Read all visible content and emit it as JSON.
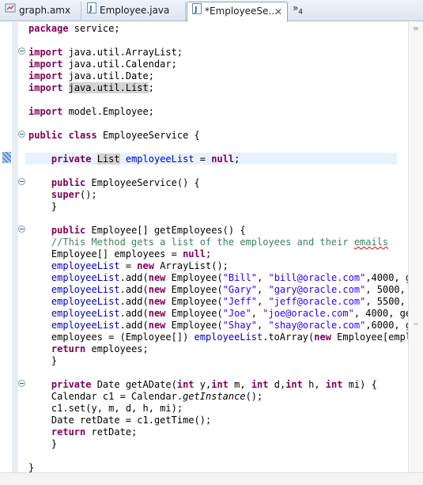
{
  "tabs": [
    {
      "label": "graph.amx",
      "icon": "amx-file-icon",
      "active": false
    },
    {
      "label": "Employee.java",
      "icon": "java-file-icon",
      "active": false
    },
    {
      "label": "*EmployeeSe...",
      "icon": "java-file-icon",
      "active": true
    }
  ],
  "tab_overflow": {
    "glyph": "»",
    "count": "4"
  },
  "close_glyph": "✕",
  "colors": {
    "keyword": "#7f0055",
    "field": "#0000c0",
    "string": "#2a00ff",
    "comment": "#3f7f5f",
    "current_line": "#e8f2fe"
  },
  "code_lines": [
    [
      {
        "t": "package",
        "c": "kw"
      },
      {
        "t": " service;"
      }
    ],
    [],
    [
      {
        "t": "import",
        "c": "kw"
      },
      {
        "t": " java.util.ArrayList;"
      }
    ],
    [
      {
        "t": "import",
        "c": "kw"
      },
      {
        "t": " java.util.Calendar;"
      }
    ],
    [
      {
        "t": "import",
        "c": "kw"
      },
      {
        "t": " java.util.Date;"
      }
    ],
    [
      {
        "t": "import",
        "c": "kw"
      },
      {
        "t": " "
      },
      {
        "t": "java.util.List",
        "c": "hl"
      },
      {
        "t": ";"
      }
    ],
    [],
    [
      {
        "t": "import",
        "c": "kw"
      },
      {
        "t": " model.Employee;"
      }
    ],
    [],
    [
      {
        "t": "public",
        "c": "kw"
      },
      {
        "t": " "
      },
      {
        "t": "class",
        "c": "kw"
      },
      {
        "t": " EmployeeService {"
      }
    ],
    [],
    [
      {
        "t": "    "
      },
      {
        "t": "private",
        "c": "kw"
      },
      {
        "t": " "
      },
      {
        "t": "List",
        "c": "hl"
      },
      {
        "t": " "
      },
      {
        "t": "employeeList",
        "c": "fld"
      },
      {
        "t": " = "
      },
      {
        "t": "null",
        "c": "kw"
      },
      {
        "t": ";"
      }
    ],
    [],
    [
      {
        "t": "    "
      },
      {
        "t": "public",
        "c": "kw"
      },
      {
        "t": " EmployeeService() {"
      }
    ],
    [
      {
        "t": "    "
      },
      {
        "t": "super",
        "c": "kw"
      },
      {
        "t": "();"
      }
    ],
    [
      {
        "t": "    }"
      }
    ],
    [],
    [
      {
        "t": "    "
      },
      {
        "t": "public",
        "c": "kw"
      },
      {
        "t": " Employee[] getEmployees() {"
      }
    ],
    [
      {
        "t": "    "
      },
      {
        "t": "//This Method gets a list of the employees and their ",
        "c": "cmt"
      },
      {
        "t": "emails",
        "c": "cmt sq"
      }
    ],
    [
      {
        "t": "    Employee[] employees = "
      },
      {
        "t": "null",
        "c": "kw"
      },
      {
        "t": ";"
      }
    ],
    [
      {
        "t": "    "
      },
      {
        "t": "employeeList",
        "c": "fld"
      },
      {
        "t": " = "
      },
      {
        "t": "new",
        "c": "kw"
      },
      {
        "t": " ArrayList();"
      }
    ],
    [
      {
        "t": "    "
      },
      {
        "t": "employeeList",
        "c": "fld"
      },
      {
        "t": ".add("
      },
      {
        "t": "new",
        "c": "kw"
      },
      {
        "t": " Employee("
      },
      {
        "t": "\"Bill\"",
        "c": "str"
      },
      {
        "t": ", "
      },
      {
        "t": "\"bill@oracle.com\"",
        "c": "str"
      },
      {
        "t": ",4000, g"
      }
    ],
    [
      {
        "t": "    "
      },
      {
        "t": "employeeList",
        "c": "fld"
      },
      {
        "t": ".add("
      },
      {
        "t": "new",
        "c": "kw"
      },
      {
        "t": " Employee("
      },
      {
        "t": "\"Gary\"",
        "c": "str"
      },
      {
        "t": ", "
      },
      {
        "t": "\"gary@oracle.com\"",
        "c": "str"
      },
      {
        "t": ", 5000, "
      }
    ],
    [
      {
        "t": "    "
      },
      {
        "t": "employeeList",
        "c": "fld"
      },
      {
        "t": ".add("
      },
      {
        "t": "new",
        "c": "kw"
      },
      {
        "t": " Employee("
      },
      {
        "t": "\"Jeff\"",
        "c": "str"
      },
      {
        "t": ", "
      },
      {
        "t": "\"jeff@oracle.com\"",
        "c": "str"
      },
      {
        "t": ", 5500, "
      }
    ],
    [
      {
        "t": "    "
      },
      {
        "t": "employeeList",
        "c": "fld"
      },
      {
        "t": ".add("
      },
      {
        "t": "new",
        "c": "kw"
      },
      {
        "t": " Employee("
      },
      {
        "t": "\"Joe\"",
        "c": "str"
      },
      {
        "t": ", "
      },
      {
        "t": "\"joe@oracle.com\"",
        "c": "str"
      },
      {
        "t": ", 4000, ge"
      }
    ],
    [
      {
        "t": "    "
      },
      {
        "t": "employeeList",
        "c": "fld"
      },
      {
        "t": ".add("
      },
      {
        "t": "new",
        "c": "kw"
      },
      {
        "t": " Employee("
      },
      {
        "t": "\"Shay\"",
        "c": "str"
      },
      {
        "t": ", "
      },
      {
        "t": "\"shay@oracle.com\"",
        "c": "str"
      },
      {
        "t": ",6000, g"
      }
    ],
    [
      {
        "t": "    employees = (Employee[]) "
      },
      {
        "t": "employeeList",
        "c": "fld"
      },
      {
        "t": ".toArray("
      },
      {
        "t": "new",
        "c": "kw"
      },
      {
        "t": " Employee[empl"
      }
    ],
    [
      {
        "t": "    "
      },
      {
        "t": "return",
        "c": "kw"
      },
      {
        "t": " employees;"
      }
    ],
    [
      {
        "t": "    }"
      }
    ],
    [],
    [
      {
        "t": "    "
      },
      {
        "t": "private",
        "c": "kw"
      },
      {
        "t": " Date getADate("
      },
      {
        "t": "int",
        "c": "kw"
      },
      {
        "t": " y,"
      },
      {
        "t": "int",
        "c": "kw"
      },
      {
        "t": " m, "
      },
      {
        "t": "int",
        "c": "kw"
      },
      {
        "t": " d,"
      },
      {
        "t": "int",
        "c": "kw"
      },
      {
        "t": " h, "
      },
      {
        "t": "int",
        "c": "kw"
      },
      {
        "t": " mi) {"
      }
    ],
    [
      {
        "t": "    Calendar c1 = Calendar."
      },
      {
        "t": "getInstance",
        "c": "it"
      },
      {
        "t": "();"
      }
    ],
    [
      {
        "t": "    c1.set(y, m, d, h, mi);"
      }
    ],
    [
      {
        "t": "    Date retDate = c1.getTime();"
      }
    ],
    [
      {
        "t": "    "
      },
      {
        "t": "return",
        "c": "kw"
      },
      {
        "t": " retDate;"
      }
    ],
    [
      {
        "t": "    }"
      }
    ],
    [],
    [
      {
        "t": "}"
      }
    ]
  ]
}
